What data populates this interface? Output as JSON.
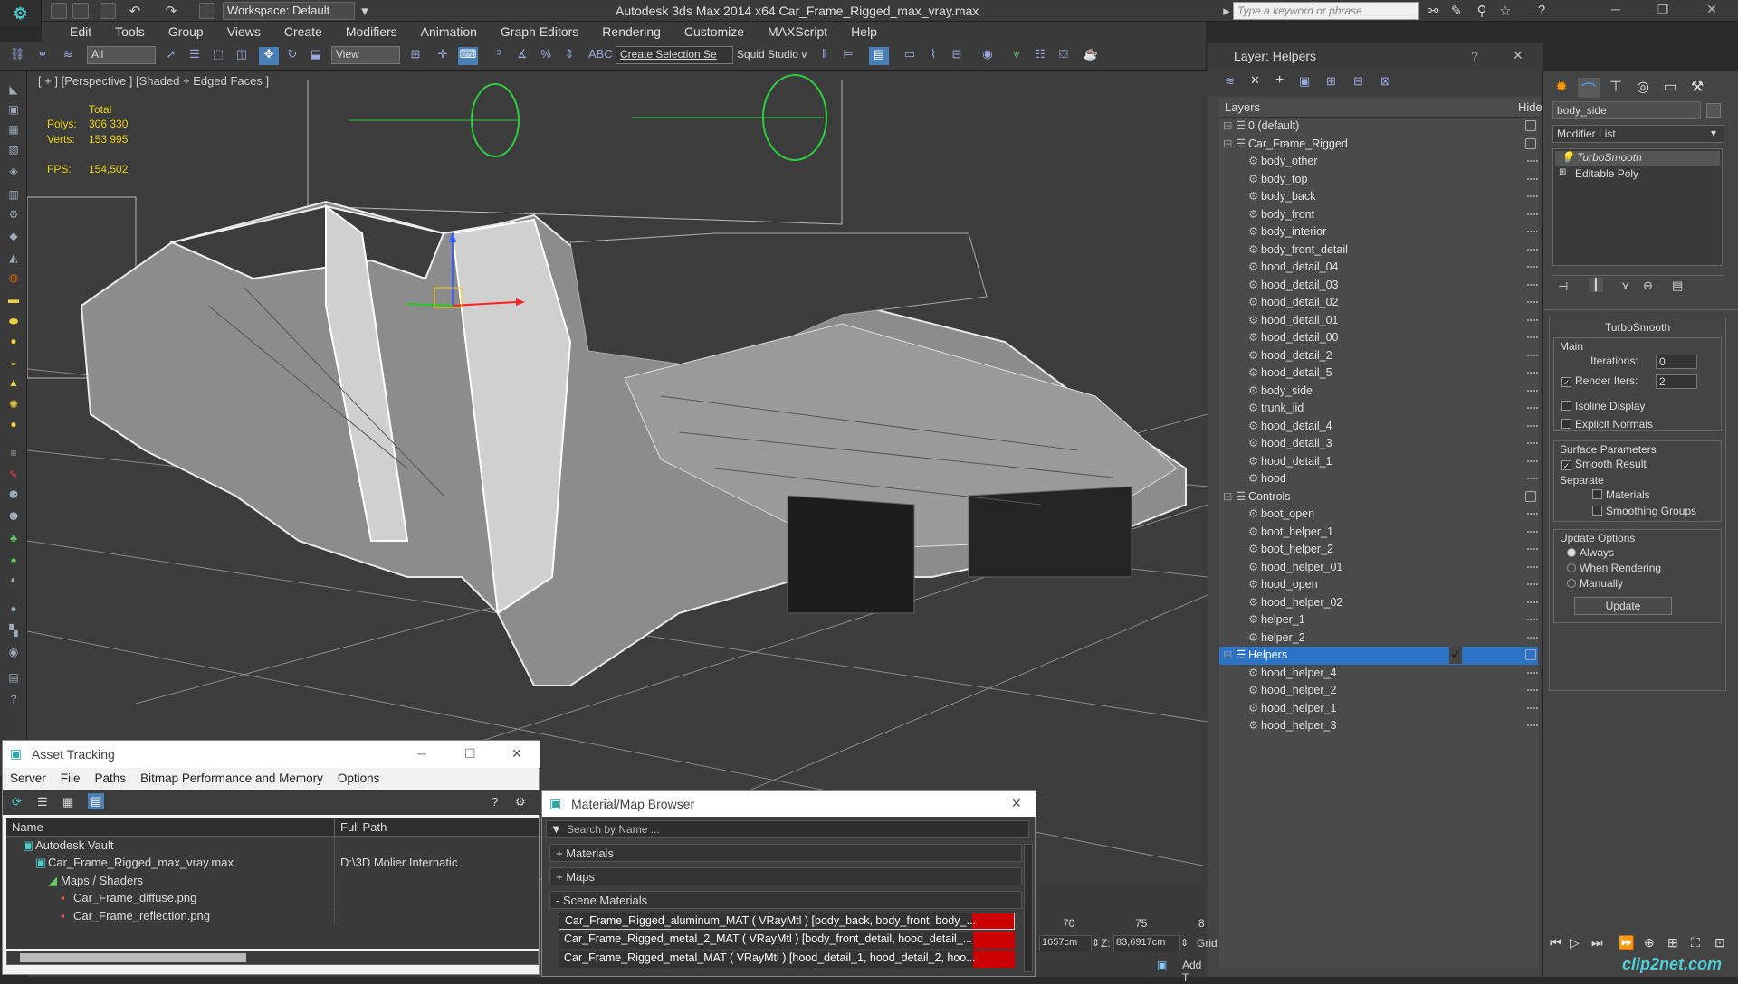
{
  "titlebar": {
    "app_title": "Autodesk 3ds Max  2014 x64     Car_Frame_Rigged_max_vray.max",
    "workspace": "Workspace: Default",
    "search_placeholder": "Type a keyword or phrase"
  },
  "menu": [
    "Edit",
    "Tools",
    "Group",
    "Views",
    "Create",
    "Modifiers",
    "Animation",
    "Graph Editors",
    "Rendering",
    "Customize",
    "MAXScript",
    "Help"
  ],
  "toolbar": {
    "filter": "All",
    "refcoord": "View",
    "selection_set": "Create Selection Se",
    "squid": "Squid Studio v"
  },
  "viewport": {
    "label": "[ + ] [Perspective ] [Shaded + Edged Faces ]",
    "stats": {
      "total_label": "Total",
      "polys_label": "Polys:",
      "polys": "306 330",
      "verts_label": "Verts:",
      "verts": "153 995",
      "fps_label": "FPS:",
      "fps": "154,502"
    }
  },
  "layer_panel": {
    "title": "Layer: Helpers",
    "col_layers": "Layers",
    "col_hide": "Hide",
    "rows": [
      {
        "name": "0 (default)",
        "indent": 0,
        "type": "layer"
      },
      {
        "name": "Car_Frame_Rigged",
        "indent": 0,
        "type": "layer"
      },
      {
        "name": "body_other",
        "indent": 1,
        "type": "obj"
      },
      {
        "name": "body_top",
        "indent": 1,
        "type": "obj"
      },
      {
        "name": "body_back",
        "indent": 1,
        "type": "obj"
      },
      {
        "name": "body_front",
        "indent": 1,
        "type": "obj"
      },
      {
        "name": "body_interior",
        "indent": 1,
        "type": "obj"
      },
      {
        "name": "body_front_detail",
        "indent": 1,
        "type": "obj"
      },
      {
        "name": "hood_detail_04",
        "indent": 1,
        "type": "obj"
      },
      {
        "name": "hood_detail_03",
        "indent": 1,
        "type": "obj"
      },
      {
        "name": "hood_detail_02",
        "indent": 1,
        "type": "obj"
      },
      {
        "name": "hood_detail_01",
        "indent": 1,
        "type": "obj"
      },
      {
        "name": "hood_detail_00",
        "indent": 1,
        "type": "obj"
      },
      {
        "name": "hood_detail_2",
        "indent": 1,
        "type": "obj"
      },
      {
        "name": "hood_detail_5",
        "indent": 1,
        "type": "obj"
      },
      {
        "name": "body_side",
        "indent": 1,
        "type": "obj"
      },
      {
        "name": "trunk_lid",
        "indent": 1,
        "type": "obj"
      },
      {
        "name": "hood_detail_4",
        "indent": 1,
        "type": "obj"
      },
      {
        "name": "hood_detail_3",
        "indent": 1,
        "type": "obj"
      },
      {
        "name": "hood_detail_1",
        "indent": 1,
        "type": "obj"
      },
      {
        "name": "hood",
        "indent": 1,
        "type": "obj"
      },
      {
        "name": "Controls",
        "indent": 0,
        "type": "layer"
      },
      {
        "name": "boot_open",
        "indent": 1,
        "type": "obj"
      },
      {
        "name": "boot_helper_1",
        "indent": 1,
        "type": "obj"
      },
      {
        "name": "boot_helper_2",
        "indent": 1,
        "type": "obj"
      },
      {
        "name": "hood_helper_01",
        "indent": 1,
        "type": "obj"
      },
      {
        "name": "hood_open",
        "indent": 1,
        "type": "obj"
      },
      {
        "name": "hood_helper_02",
        "indent": 1,
        "type": "obj"
      },
      {
        "name": "helper_1",
        "indent": 1,
        "type": "obj"
      },
      {
        "name": "helper_2",
        "indent": 1,
        "type": "obj"
      },
      {
        "name": "Helpers",
        "indent": 0,
        "type": "layer",
        "selected": true
      },
      {
        "name": "hood_helper_4",
        "indent": 1,
        "type": "obj"
      },
      {
        "name": "hood_helper_2",
        "indent": 1,
        "type": "obj"
      },
      {
        "name": "hood_helper_1",
        "indent": 1,
        "type": "obj"
      },
      {
        "name": "hood_helper_3",
        "indent": 1,
        "type": "obj"
      }
    ]
  },
  "command_panel": {
    "object_name": "body_side",
    "modifier_list": "Modifier List",
    "stack": [
      "TurboSmooth",
      "Editable Poly"
    ],
    "turbosmooth": {
      "header": "TurboSmooth",
      "main": "Main",
      "iterations_label": "Iterations:",
      "iterations": "0",
      "render_iters_label": "Render Iters:",
      "render_iters": "2",
      "isoline": "Isoline Display",
      "explicit": "Explicit Normals",
      "surface": "Surface Parameters",
      "smooth_result": "Smooth Result",
      "separate": "Separate",
      "materials": "Materials",
      "smoothing_groups": "Smoothing Groups",
      "update_options": "Update Options",
      "always": "Always",
      "when_rendering": "When Rendering",
      "manually": "Manually",
      "update_btn": "Update"
    }
  },
  "asset_tracking": {
    "title": "Asset Tracking",
    "menu": [
      "Server",
      "File",
      "Paths",
      "Bitmap Performance and Memory",
      "Options"
    ],
    "col_name": "Name",
    "col_path": "Full Path",
    "rows": [
      {
        "name": "Autodesk Vault",
        "path": "",
        "indent": 1
      },
      {
        "name": "Car_Frame_Rigged_max_vray.max",
        "path": "D:\\3D Molier Internatic",
        "indent": 2
      },
      {
        "name": "Maps / Shaders",
        "path": "",
        "indent": 3
      },
      {
        "name": "Car_Frame_diffuse.png",
        "path": "",
        "indent": 4
      },
      {
        "name": "Car_Frame_reflection.png",
        "path": "",
        "indent": 4
      }
    ]
  },
  "material_browser": {
    "title": "Material/Map Browser",
    "search": "Search by Name ...",
    "sections": [
      "+ Materials",
      "+ Maps",
      "- Scene Materials"
    ],
    "materials": [
      "Car_Frame_Rigged_aluminum_MAT ( VRayMtl ) [body_back, body_front, body_...",
      "Car_Frame_Rigged_metal_2_MAT ( VRayMtl ) [body_front_detail, hood_detail_...",
      "Car_Frame_Rigged_metal_MAT ( VRayMtl ) [hood_detail_1, hood_detail_2, hoo..."
    ]
  },
  "timeline": {
    "ticks": [
      "70",
      "75",
      "8"
    ],
    "x_coord": "1657cm",
    "z_label": "Z:",
    "z_coord": "83,6917cm",
    "grid": "Grid",
    "add": "Add T"
  },
  "watermark": "clip2net.com"
}
